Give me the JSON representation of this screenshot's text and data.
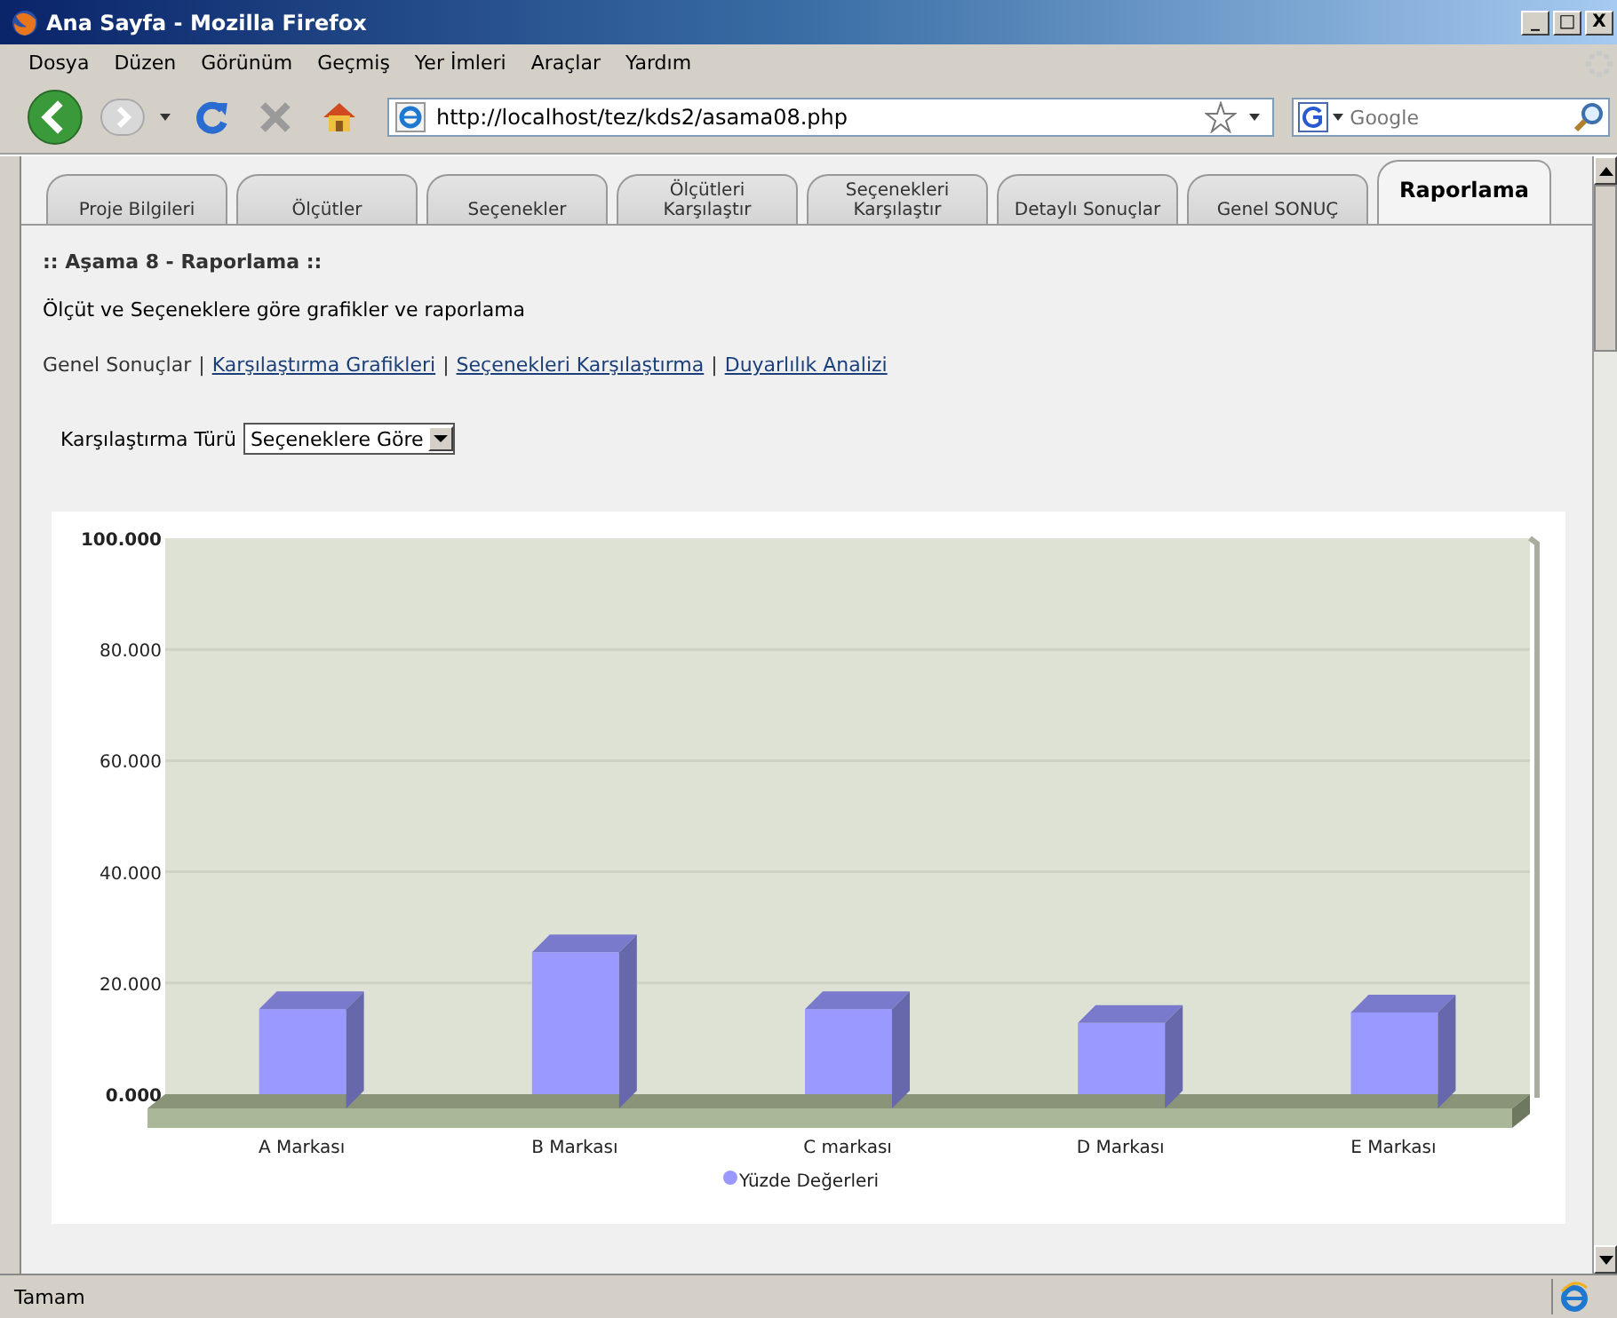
{
  "window": {
    "title": "Ana Sayfa - Mozilla Firefox",
    "controls": [
      "_",
      "□",
      "X"
    ]
  },
  "menu": [
    "Dosya",
    "Düzen",
    "Görünüm",
    "Geçmiş",
    "Yer İmleri",
    "Araçlar",
    "Yardım"
  ],
  "toolbar": {
    "url": "http://localhost/tez/kds2/asama08.php",
    "search_placeholder": "Google"
  },
  "tabs": [
    {
      "lines": [
        "Proje Bilgileri"
      ],
      "selected": false
    },
    {
      "lines": [
        "Ölçütler"
      ],
      "selected": false
    },
    {
      "lines": [
        "Seçenekler"
      ],
      "selected": false
    },
    {
      "lines": [
        "Ölçütleri",
        "Karşılaştır"
      ],
      "selected": false
    },
    {
      "lines": [
        "Seçenekleri",
        "Karşılaştır"
      ],
      "selected": false
    },
    {
      "lines": [
        "Detaylı Sonuçlar"
      ],
      "selected": false
    },
    {
      "lines": [
        "Genel SONUÇ"
      ],
      "selected": false
    },
    {
      "lines": [
        "Raporlama"
      ],
      "selected": true
    }
  ],
  "heading": ":: Aşama 8 - Raporlama  ::",
  "description": "Ölçüt ve Seçeneklere göre grafikler ve raporlama",
  "nav_links": [
    {
      "kind": "current",
      "label": "Genel Sonuçlar"
    },
    {
      "kind": "separator",
      "label": "|"
    },
    {
      "kind": "link",
      "label": "Karşılaştırma Grafikleri"
    },
    {
      "kind": "separator",
      "label": "|"
    },
    {
      "kind": "link",
      "label": "Seçenekleri Karşılaştırma"
    },
    {
      "kind": "separator",
      "label": "|"
    },
    {
      "kind": "link",
      "label": "Duyarlılık Analizi"
    }
  ],
  "comparison": {
    "label": "Karşılaştırma Türü",
    "value": "Seçeneklere Göre"
  },
  "chart_data": {
    "type": "bar",
    "categories": [
      "A Markası",
      "B Markası",
      "C markası",
      "D Markası",
      "E Markası"
    ],
    "series": [
      {
        "name": "Yüzde Değerleri",
        "color": "#9999ff",
        "values": [
          15.3,
          25.5,
          15.3,
          12.8,
          14.7
        ]
      }
    ],
    "ylim": [
      0,
      100
    ],
    "grid": true,
    "yticks": [
      {
        "value": 0,
        "label": "0.000"
      },
      {
        "value": 20,
        "label": "20.000"
      },
      {
        "value": 40,
        "label": "40.000"
      },
      {
        "value": 60,
        "label": "60.000"
      },
      {
        "value": 80,
        "label": "80.000"
      },
      {
        "value": 100,
        "label": "100.000"
      }
    ]
  },
  "status_bar": {
    "text": "Tamam"
  }
}
